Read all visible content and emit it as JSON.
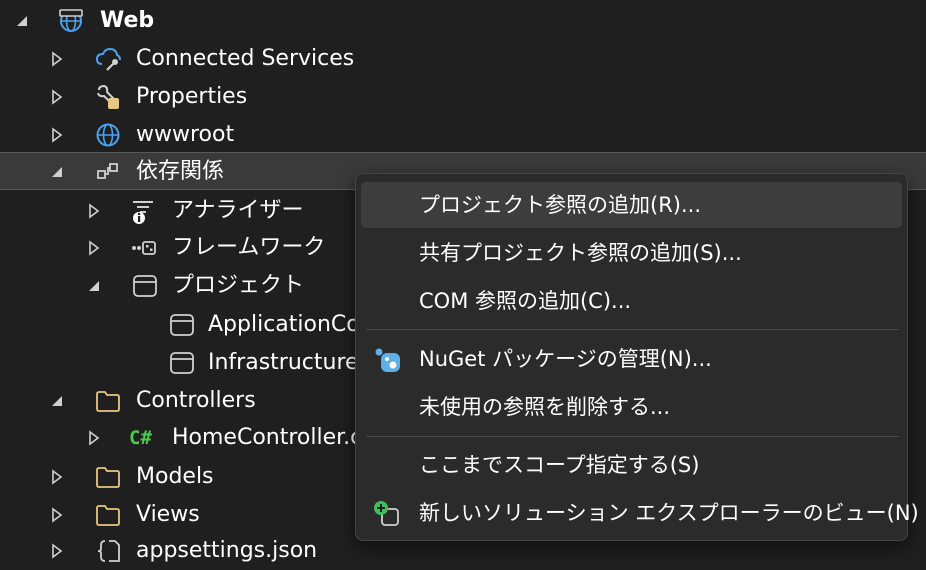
{
  "tree": [
    {
      "label": "Web",
      "icon": "web-project-icon",
      "expanded": true,
      "bold": true
    },
    {
      "label": "Connected Services",
      "icon": "connected-services-icon",
      "expanded": false
    },
    {
      "label": "Properties",
      "icon": "properties-wrench-icon",
      "expanded": false
    },
    {
      "label": "wwwroot",
      "icon": "globe-icon",
      "expanded": false
    },
    {
      "label": "依存関係",
      "icon": "dependencies-icon",
      "expanded": true,
      "selected": true
    },
    {
      "label": "アナライザー",
      "icon": "analyzer-icon",
      "expanded": false
    },
    {
      "label": "フレームワーク",
      "icon": "framework-icon",
      "expanded": false
    },
    {
      "label": "プロジェクト",
      "icon": "project-box-icon",
      "expanded": true
    },
    {
      "label": "ApplicationCo",
      "icon": "project-box-icon"
    },
    {
      "label": "Infrastructure",
      "icon": "project-box-icon"
    },
    {
      "label": "Controllers",
      "icon": "folder-icon",
      "expanded": true
    },
    {
      "label": "HomeController.c",
      "icon": "csharp-file-icon",
      "icon_text": "C#",
      "expanded": false
    },
    {
      "label": "Models",
      "icon": "folder-icon",
      "expanded": false
    },
    {
      "label": "Views",
      "icon": "folder-icon",
      "expanded": false
    },
    {
      "label": "appsettings.json",
      "icon": "json-file-icon",
      "expanded": false
    }
  ],
  "context_menu": {
    "items": [
      {
        "label": "プロジェクト参照の追加(R)...",
        "hovered": true
      },
      {
        "label": "共有プロジェクト参照の追加(S)..."
      },
      {
        "label": "COM 参照の追加(C)..."
      },
      {
        "label": "NuGet パッケージの管理(N)...",
        "icon": "nuget-icon"
      },
      {
        "label": "未使用の参照を削除する..."
      },
      {
        "label": "ここまでスコープ指定する(S)"
      },
      {
        "label": "新しいソリューション エクスプローラーのビュー(N)",
        "icon": "new-view-icon"
      }
    ]
  },
  "colors": {
    "background": "#1f1f1f",
    "selected_row": "#3a3a3a",
    "menu_bg": "#2b2b2b",
    "menu_hover": "#3d3d3d",
    "folder": "#e8c783",
    "globe": "#4aa3f0",
    "csharp": "#4ec94e",
    "nuget": "#5fb0e8",
    "add_green": "#3fbf5a"
  }
}
